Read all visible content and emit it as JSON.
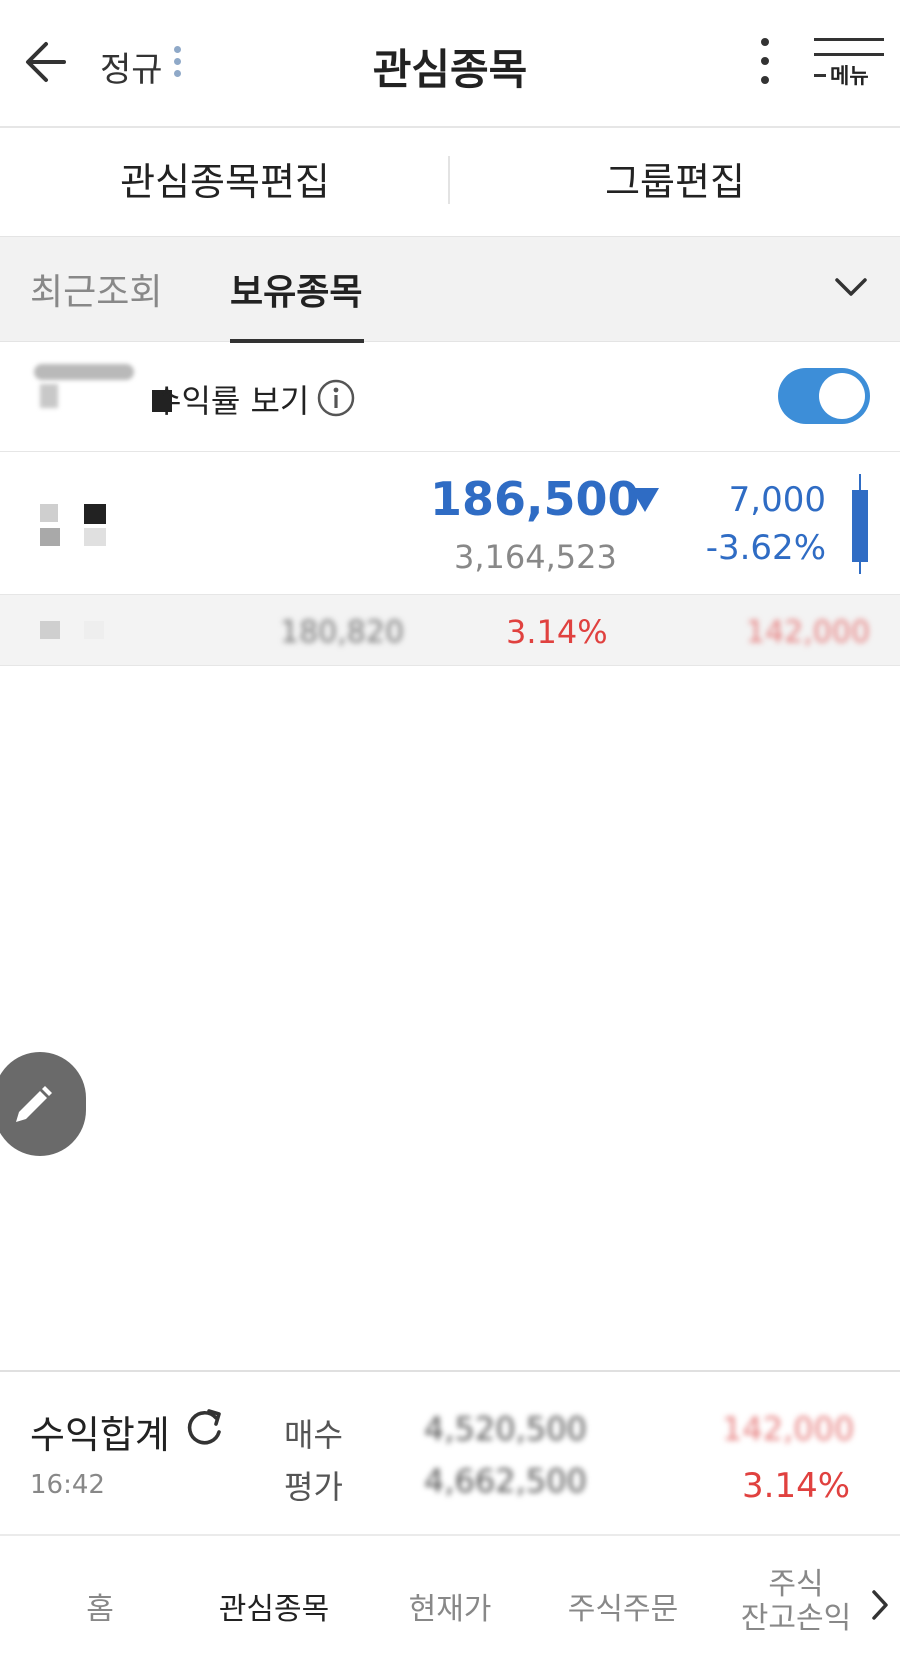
{
  "header": {
    "session_label": "정규",
    "title": "관심종목",
    "menu_label": "메뉴"
  },
  "edit_bar": {
    "watchlist_edit": "관심종목편집",
    "group_edit": "그룹편집"
  },
  "groups": {
    "tabs": [
      {
        "label": "최근조회",
        "active": false
      },
      {
        "label": "보유종목",
        "active": true
      }
    ]
  },
  "toggle_row": {
    "label": "수익률 보기",
    "enabled": true
  },
  "stock": {
    "price": "186,500",
    "volume": "3,164,523",
    "change_amount": "7,000",
    "change_percent": "-3.62%",
    "avg_price": "180,820",
    "profit_percent": "3.14%",
    "profit_amount": "142,000"
  },
  "summary": {
    "title": "수익합계",
    "time": "16:42",
    "buy_label": "매수",
    "eval_label": "평가",
    "buy_value": "4,520,500",
    "eval_value": "4,662,500",
    "profit_amount": "142,000",
    "profit_percent": "3.14%"
  },
  "bottom_nav": {
    "items": [
      {
        "label": "홈",
        "active": false
      },
      {
        "label": "관심종목",
        "active": true
      },
      {
        "label": "현재가",
        "active": false
      },
      {
        "label": "주식주문",
        "active": false
      },
      {
        "label_line1": "주식",
        "label_line2": "잔고손익",
        "active": false
      }
    ]
  },
  "colors": {
    "down_blue": "#2f6cc4",
    "up_red": "#e0413f",
    "toggle_blue": "#3d8ed8"
  }
}
